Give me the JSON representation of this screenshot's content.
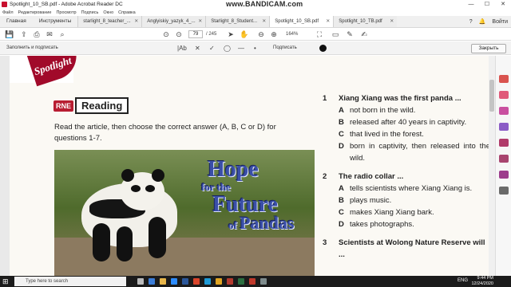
{
  "window": {
    "title": "Spotlight_10_SB.pdf - Adobe Acrobat Reader DC",
    "watermark": "www.BANDICAM.com",
    "minimize": "—",
    "maximize": "☐",
    "close": "✕"
  },
  "menu": [
    "Файл",
    "Редактирование",
    "Просмотр",
    "Подпись",
    "Окно",
    "Справка"
  ],
  "nav": {
    "home": "Главная",
    "tools": "Инструменты"
  },
  "tabs": [
    {
      "label": "starlight_8_teacher_..."
    },
    {
      "label": "Anglyiskiy_yazyk_4_..."
    },
    {
      "label": "Starlight_8_Student..."
    },
    {
      "label": "Spotlight_10_SB.pdf"
    },
    {
      "label": "Spotlight_10_TB.pdf"
    }
  ],
  "account": {
    "help": "?",
    "bell": "🔔",
    "signin": "Войти"
  },
  "toolbar": {
    "page_current": "79",
    "page_total": "/ 245",
    "zoom": "164%"
  },
  "signbar": {
    "label": "Заполнить и подписать",
    "text_tool": "|Ab",
    "cross_tool": "✕",
    "check_tool": "✓",
    "ellipse_tool": "◯",
    "line_tool": "—",
    "dot_tool": "•",
    "sign_label": "Подписать",
    "close_label": "Закрыть"
  },
  "document": {
    "banner": "Spotlight",
    "badge_rne": "RNE",
    "badge_word": "Reading",
    "instructions": "Read the article, then choose the correct answer (A, B, C or D) for questions 1-7.",
    "photo_title": {
      "l1": "Hope",
      "l2": "for the",
      "l3": "Future",
      "l4a": "of ",
      "l4b": "Pandas"
    },
    "questions": [
      {
        "num": "1",
        "stem": "Xiang Xiang was the first panda ...",
        "options": [
          {
            "letter": "A",
            "text": "not born in the wild."
          },
          {
            "letter": "B",
            "text": "released after 40 years in captivity."
          },
          {
            "letter": "C",
            "text": "that lived in the forest."
          },
          {
            "letter": "D",
            "text": "born in captivity, then released into the wild."
          }
        ]
      },
      {
        "num": "2",
        "stem": "The radio collar ...",
        "options": [
          {
            "letter": "A",
            "text": "tells scientists where Xiang Xiang is."
          },
          {
            "letter": "B",
            "text": "plays music."
          },
          {
            "letter": "C",
            "text": "makes Xiang Xiang bark."
          },
          {
            "letter": "D",
            "text": "takes photographs."
          }
        ]
      },
      {
        "num": "3",
        "stem": "Scientists at Wolong Nature Reserve will ..."
      }
    ]
  },
  "taskbar": {
    "search_placeholder": "Type here to search",
    "lang": "ENG",
    "time": "9:44 PM",
    "date": "12/24/2020"
  }
}
